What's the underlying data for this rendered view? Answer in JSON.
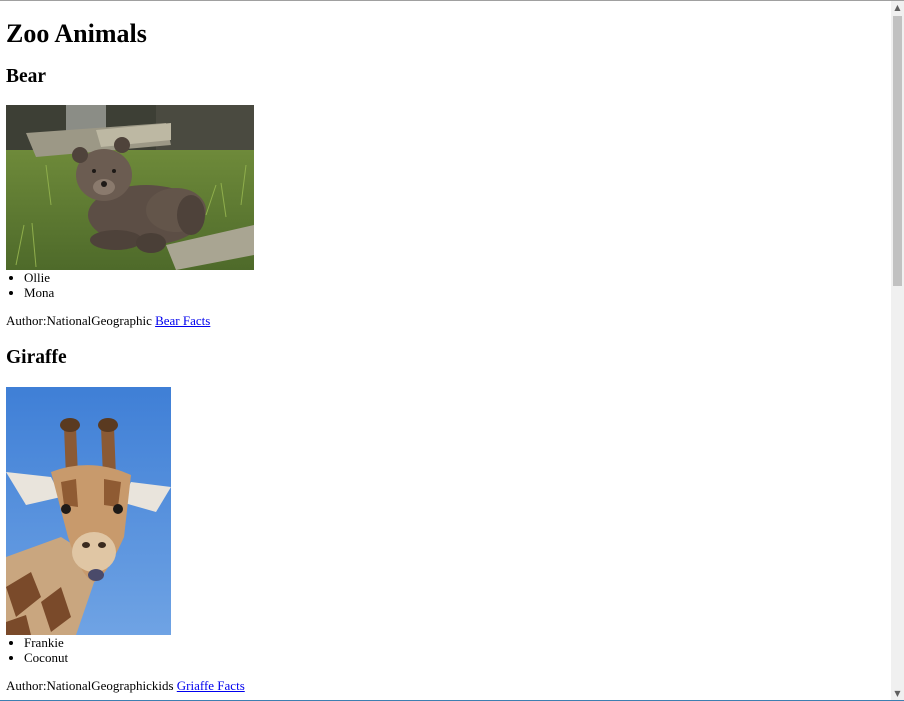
{
  "page": {
    "title": "Zoo Animals"
  },
  "animals": [
    {
      "name": "Bear",
      "image_icon": "bear-photo",
      "keepers": [
        "Ollie",
        "Mona"
      ],
      "author_label": "Author:NationalGeographic",
      "link_text": "Bear Facts"
    },
    {
      "name": "Giraffe",
      "image_icon": "giraffe-photo",
      "keepers": [
        "Frankie",
        "Coconut"
      ],
      "author_label": "Author:NationalGeographickids",
      "link_text": "Griaffe Facts"
    }
  ],
  "scrollbar": {
    "up_icon": "scroll-up-arrow-icon",
    "down_icon": "scroll-down-arrow-icon",
    "position_fraction": 0.0
  }
}
